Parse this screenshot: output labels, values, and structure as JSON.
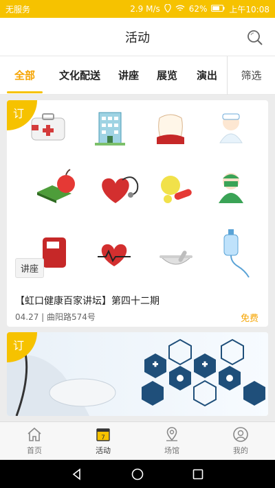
{
  "status": {
    "carrier": "无服务",
    "net_speed": "2.9 M/s",
    "battery": "62%",
    "time": "上午10:08"
  },
  "header": {
    "title": "活动"
  },
  "tabs": [
    {
      "label": "全部"
    },
    {
      "label": "文化配送"
    },
    {
      "label": "讲座"
    },
    {
      "label": "展览"
    },
    {
      "label": "演出"
    },
    {
      "label": "筛选"
    }
  ],
  "cards": [
    {
      "badge": "订",
      "tag": "讲座",
      "title": "【虹口健康百家讲坛】第四十二期",
      "meta": "04.27 | 曲阳路574号",
      "price": "免费",
      "icons": [
        "medical-kit-icon",
        "hospital-building-icon",
        "tooth-icon",
        "nurse-icon",
        "medicine-book-apple-icon",
        "heart-stethoscope-icon",
        "pills-icon",
        "doctor-icon",
        "blood-bag-icon",
        "heartbeat-icon",
        "mortar-pestle-icon",
        "iv-drip-icon"
      ]
    },
    {
      "badge": "订"
    }
  ],
  "bottom_nav": [
    {
      "label": "首页"
    },
    {
      "label": "活动"
    },
    {
      "label": "场馆"
    },
    {
      "label": "我的"
    }
  ],
  "colors": {
    "accent": "#f6c200",
    "active_text": "#f6a400"
  }
}
